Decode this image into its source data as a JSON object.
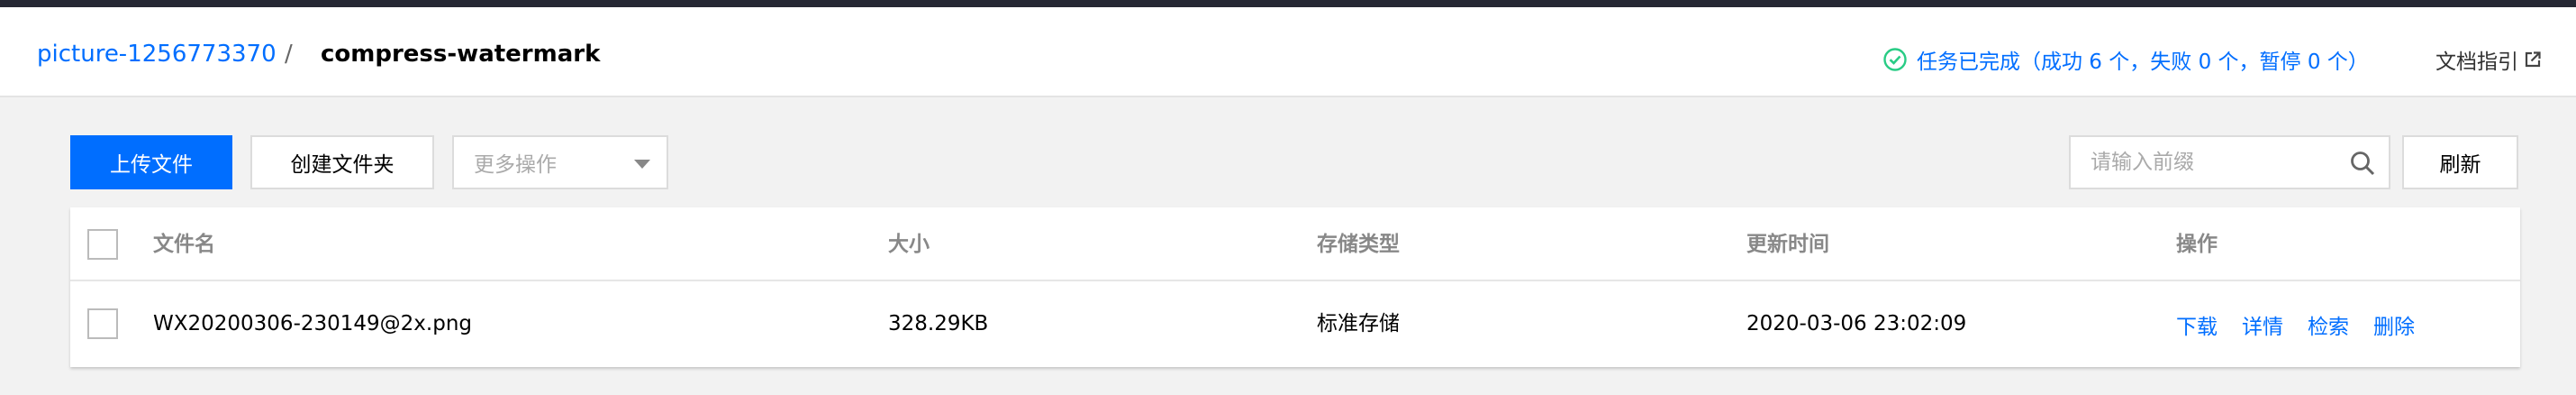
{
  "breadcrumb": {
    "bucket": "picture-1256773370",
    "separator": "/",
    "current": "compress-watermark"
  },
  "header": {
    "task_status": "任务已完成（成功 6 个，失败 0 个，暂停 0 个）",
    "doc_guide": "文档指引"
  },
  "toolbar": {
    "upload_label": "上传文件",
    "mkdir_label": "创建文件夹",
    "more_actions_label": "更多操作",
    "search_placeholder": "请输入前缀",
    "refresh_label": "刷新"
  },
  "table": {
    "columns": [
      "文件名",
      "大小",
      "存储类型",
      "更新时间",
      "操作"
    ],
    "rows": [
      {
        "name": "WX20200306-230149@2x.png",
        "size": "328.29KB",
        "storage_class": "标准存储",
        "updated": "2020-03-06 23:02:09",
        "actions": [
          "下载",
          "详情",
          "检索",
          "删除"
        ]
      }
    ]
  },
  "colors": {
    "accent": "#006eff",
    "success": "#29cc85",
    "topbar": "#262834"
  },
  "icons": [
    "check-circle-icon",
    "external-link-icon",
    "search-icon",
    "chevron-down-icon"
  ]
}
